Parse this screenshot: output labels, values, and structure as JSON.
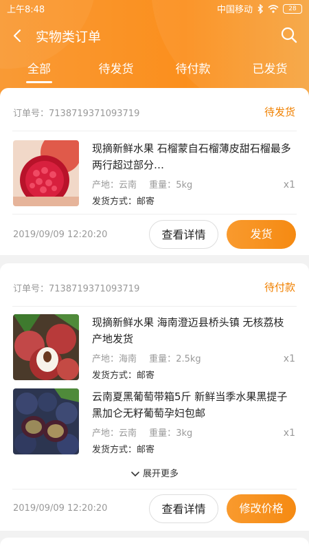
{
  "status_bar": {
    "time": "上午8:48",
    "carrier": "中国移动",
    "battery": "28"
  },
  "header": {
    "title": "实物类订单"
  },
  "tabs": [
    {
      "label": "全部",
      "active": true
    },
    {
      "label": "待发货",
      "active": false
    },
    {
      "label": "待付款",
      "active": false
    },
    {
      "label": "已发货",
      "active": false
    }
  ],
  "orders": [
    {
      "order_no": "订单号：7138719371093719",
      "status": "待发货",
      "items": [
        {
          "name": "现摘新鲜水果 石榴蒙自石榴薄皮甜石榴最多两行超过部分…",
          "origin_label": "产地：",
          "origin": "云南",
          "weight_label": "重量：",
          "weight": "5kg",
          "qty": "x1",
          "shipping_label": "发货方式：",
          "shipping": "邮寄"
        }
      ],
      "date": "2019/09/09 12:20:20",
      "detail_btn": "查看详情",
      "action_btn": "发货"
    },
    {
      "order_no": "订单号：7138719371093719",
      "status": "待付款",
      "items": [
        {
          "name": "现摘新鲜水果 海南澄迈县桥头镇 无核荔枝 产地发货",
          "origin_label": "产地：",
          "origin": "海南",
          "weight_label": "重量：",
          "weight": "2.5kg",
          "qty": "x1",
          "shipping_label": "发货方式：",
          "shipping": "邮寄"
        },
        {
          "name": "云南夏黑葡萄带箱5斤 新鲜当季水果黑提子黑加仑无籽葡萄孕妇包邮",
          "origin_label": "产地：",
          "origin": "云南",
          "weight_label": "重量：",
          "weight": "3kg",
          "qty": "x1",
          "shipping_label": "发货方式：",
          "shipping": "邮寄"
        }
      ],
      "expand_label": "展开更多",
      "date": "2019/09/09 12:20:20",
      "detail_btn": "查看详情",
      "action_btn": "修改价格"
    }
  ],
  "colors": {
    "accent": "#f58a12",
    "status_text": "#f08000"
  }
}
